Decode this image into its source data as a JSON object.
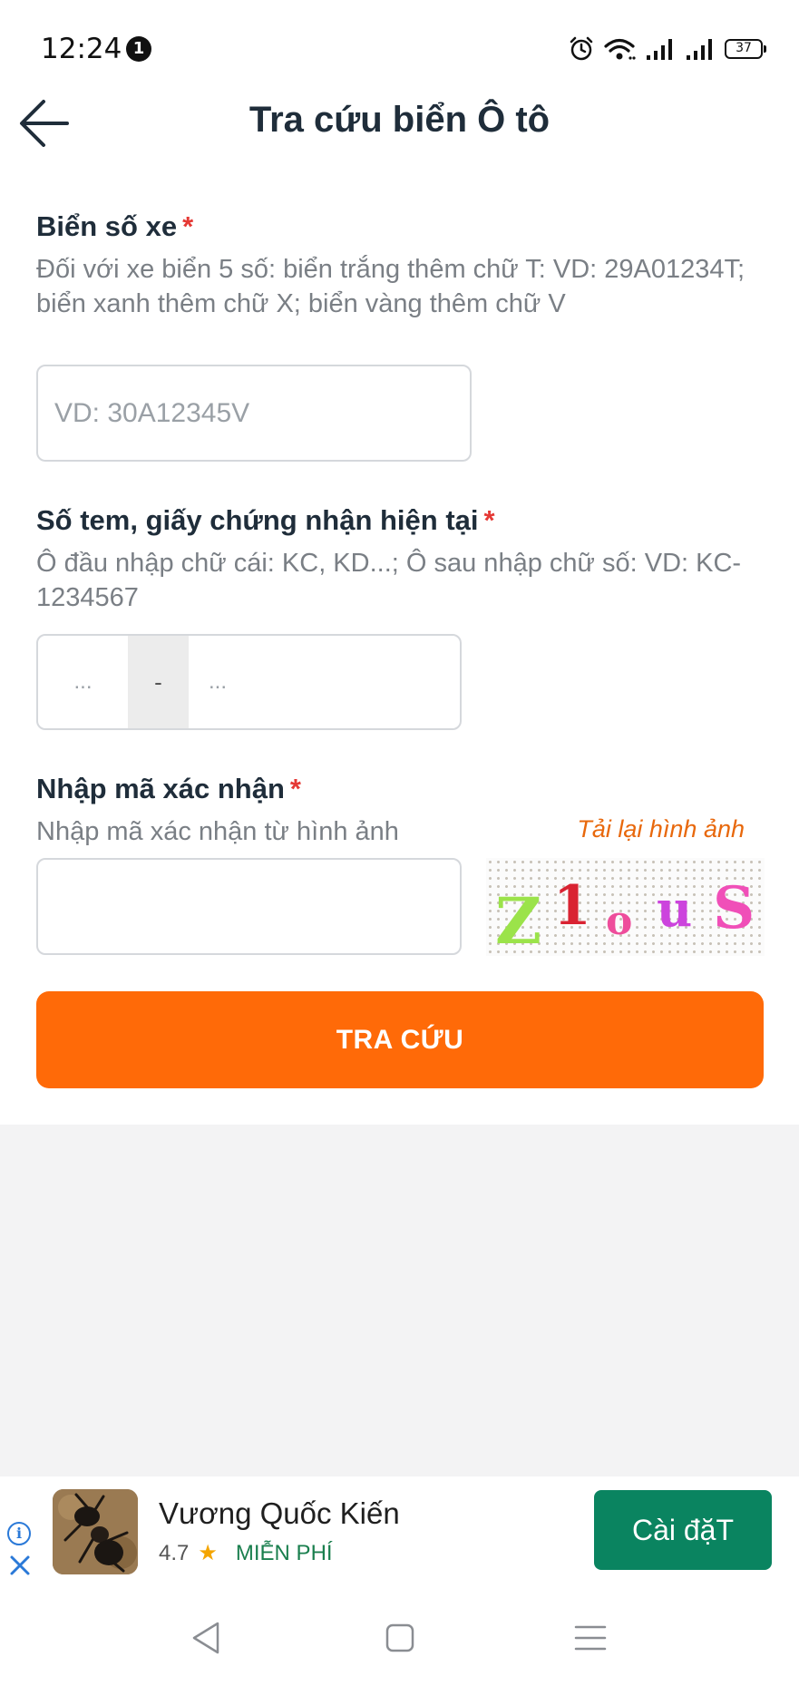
{
  "status_bar": {
    "time": "12:24",
    "notification_count": "1",
    "battery": "37"
  },
  "header": {
    "title": "Tra cứu biển Ô tô"
  },
  "plate_field": {
    "label": "Biển số xe",
    "required_mark": "*",
    "hint": "Đối với xe biển 5 số: biển trắng thêm chữ T: VD: 29A01234T; biển xanh thêm chữ X; biển vàng thêm chữ V",
    "placeholder": "VD: 30A12345V",
    "value": ""
  },
  "stamp_field": {
    "label": "Số tem, giấy chứng nhận hiện tại",
    "required_mark": "*",
    "hint": "Ô đầu nhập chữ cái: KC, KD...; Ô sau nhập chữ số: VD: KC-1234567",
    "left_placeholder": "...",
    "separator": "-",
    "right_placeholder": "..."
  },
  "captcha_field": {
    "label": "Nhập mã xác nhận",
    "required_mark": "*",
    "hint": "Nhập mã xác nhận từ hình ảnh",
    "reload_label": "Tải lại hình ảnh",
    "value": "",
    "captcha_chars": [
      {
        "char": "Z",
        "color": "#9be34a"
      },
      {
        "char": "1",
        "color": "#d92332"
      },
      {
        "char": "o",
        "color": "#ee4d9b"
      },
      {
        "char": "u",
        "color": "#cc44dd"
      },
      {
        "char": "S",
        "color": "#f04fb8"
      }
    ]
  },
  "submit": {
    "label": "TRA CỨU"
  },
  "ad": {
    "info_label": "i",
    "app_name": "Vương Quốc Kiến",
    "rating": "4.7",
    "price": "MIỄN PHÍ",
    "cta_label": "Cài đặT"
  },
  "colors": {
    "accent": "#ff6a08",
    "required": "#e53935",
    "ad_cta": "#0a8460"
  }
}
